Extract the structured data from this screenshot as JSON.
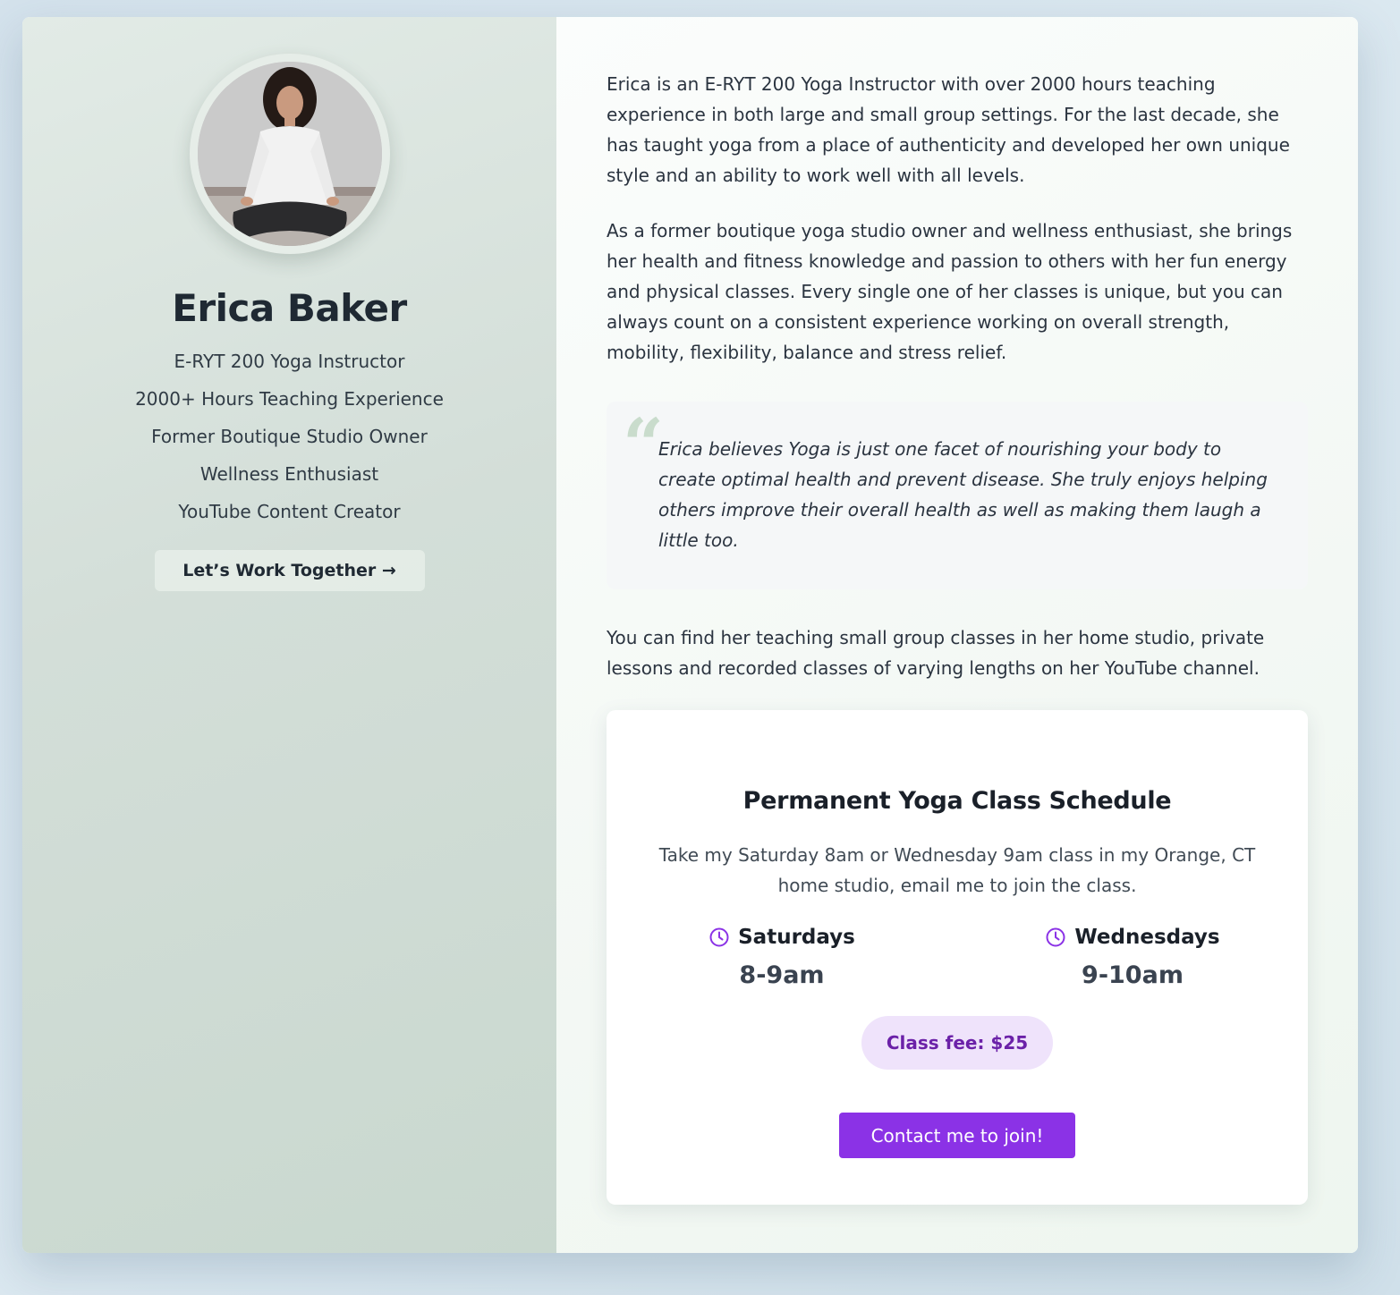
{
  "profile": {
    "name": "Erica Baker",
    "credentials": [
      "E-RYT 200 Yoga Instructor",
      "2000+ Hours Teaching Experience",
      "Former Boutique Studio Owner",
      "Wellness Enthusiast",
      "YouTube Content Creator"
    ],
    "cta_label": "Let’s Work Together →"
  },
  "bio": {
    "paragraph_1": "Erica is an E-RYT 200 Yoga Instructor with over 2000 hours teaching experience in both large and small group settings. For the last decade, she has taught yoga from a place of authenticity and developed her own unique style and an ability to work well with all levels.",
    "paragraph_2": "As a former boutique yoga studio owner and wellness enthusiast, she brings her health and fitness knowledge and passion to others with her fun energy and physical classes. Every single one of her classes is unique, but you can always count on a consistent experience working on overall strength, mobility, flexibility, balance and stress relief.",
    "quote": "Erica believes Yoga is just one facet of nourishing your body to create optimal health and prevent disease. She truly enjoys helping others improve their overall health as well as making them laugh a little too.",
    "paragraph_3": "You can find her teaching small group classes in her home studio, private lessons and recorded classes of varying lengths on her YouTube channel."
  },
  "schedule": {
    "title": "Permanent Yoga Class Schedule",
    "description": "Take my Saturday 8am or Wednesday 9am class in my Orange, CT home studio, email me to join the class.",
    "days": [
      {
        "day": "Saturdays",
        "time": "8-9am",
        "icon": "clock-icon"
      },
      {
        "day": "Wednesdays",
        "time": "9-10am",
        "icon": "clock-icon"
      }
    ],
    "fee": "Class fee: $25",
    "button_label": "Contact me to join!"
  },
  "colors": {
    "accent": "#8b32e6",
    "fee_bg": "#efe3fb",
    "fee_text": "#6b21a8",
    "left_panel": "#d3ded8"
  }
}
